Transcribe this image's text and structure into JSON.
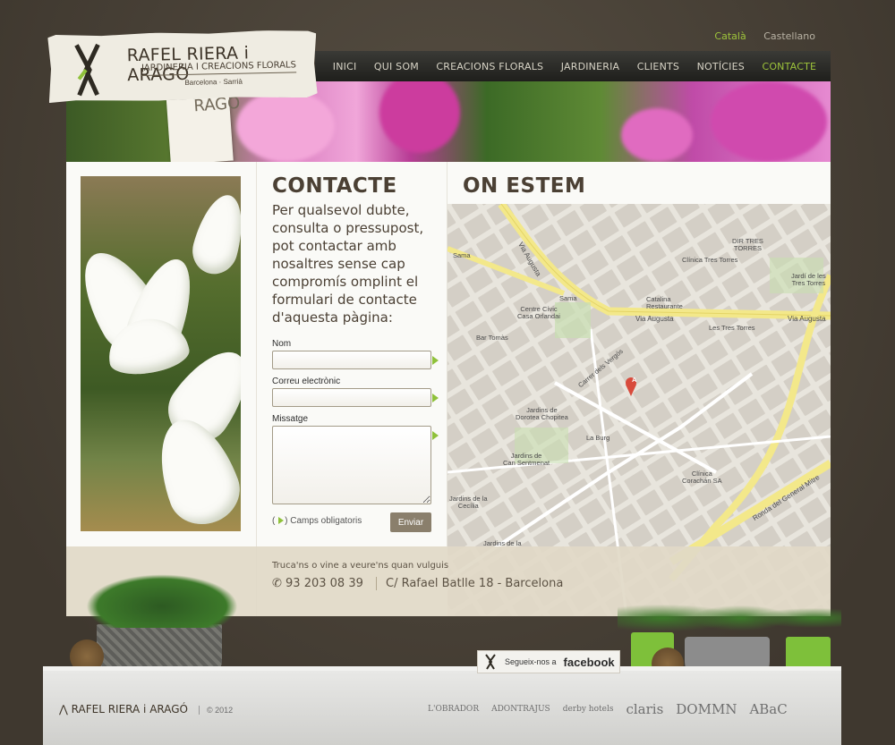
{
  "languages": [
    {
      "label": "Català",
      "active": true
    },
    {
      "label": "Castellano",
      "active": false
    }
  ],
  "logo": {
    "title": "RAFEL RIERA i ARAGÓ",
    "subtitle": "JARDINERIA I CREACIONS FLORALS",
    "city": "Barcelona · Sarrià"
  },
  "tag_text": "RAGÓ",
  "nav": [
    {
      "label": "INICI",
      "active": false
    },
    {
      "label": "QUI SOM",
      "active": false
    },
    {
      "label": "CREACIONS FLORALS",
      "active": false
    },
    {
      "label": "JARDINERIA",
      "active": false
    },
    {
      "label": "CLIENTS",
      "active": false
    },
    {
      "label": "NOTÍCIES",
      "active": false
    },
    {
      "label": "CONTACTE",
      "active": true
    }
  ],
  "contact": {
    "title": "CONTACTE",
    "intro": "Per qualsevol dubte, consulta o pressupost, pot contactar amb nosaltres sense cap compromís omplint el formulari de contacte d'aquesta pàgina:",
    "name_label": "Nom",
    "email_label": "Correu electrònic",
    "message_label": "Missatge",
    "required_note_open": "(",
    "required_note": ") Camps obligatoris",
    "send_label": "Enviar"
  },
  "map": {
    "title": "ON ESTEM",
    "marker": "A",
    "labels": {
      "sama": "Sama",
      "via_augusta_1": "Via Augusta",
      "sama2": "Sama",
      "centre_civic": "Centre Cívic\nCasa Orlandai",
      "bar_tomas": "Bar Tomàs",
      "catalina": "Catalina\nRestaurante",
      "clinica_tres": "Clínica Tres Torres",
      "dir_tres": "DIR TRES\nTORRES",
      "jardi": "Jardí de les\nTres Torres",
      "via_augusta_2": "Via Augusta",
      "via_augusta_3": "Via Augusta",
      "les_tres": "Les Tres Torres",
      "carrer_vergos": "Carrer dels Vergós",
      "jardins_dorotea": "Jardins de\nDorotea Chopitea",
      "la_burg": "La Burg",
      "jardins_can": "Jardins de\nCan Sentmenat",
      "clinica_corachan": "Clínica\nCorachán SA",
      "ronda": "Ronda del General Mitre",
      "cecilia": "Jardins de la\nCecília",
      "jardins_de": "Jardins de la"
    }
  },
  "footer_band": {
    "prompt": "Truca'ns o vine a veure'ns quan vulguis",
    "phone": "93 203 08 39",
    "address": "C/ Rafael Batlle 18 - Barcelona"
  },
  "facebook": {
    "follow": "Segueix-nos a",
    "brand": "facebook"
  },
  "footer": {
    "logo": "RAFEL RIERA i ARAGÓ",
    "copyright": "© 2012",
    "partners": [
      "L'OBRADOR",
      "ADONTRAJUS",
      "derby hotels",
      "claris",
      "DOMMN",
      "ABaC"
    ]
  },
  "colors": {
    "accent": "#9ec43b",
    "background": "#4a4338",
    "button": "#8a7f6c"
  }
}
